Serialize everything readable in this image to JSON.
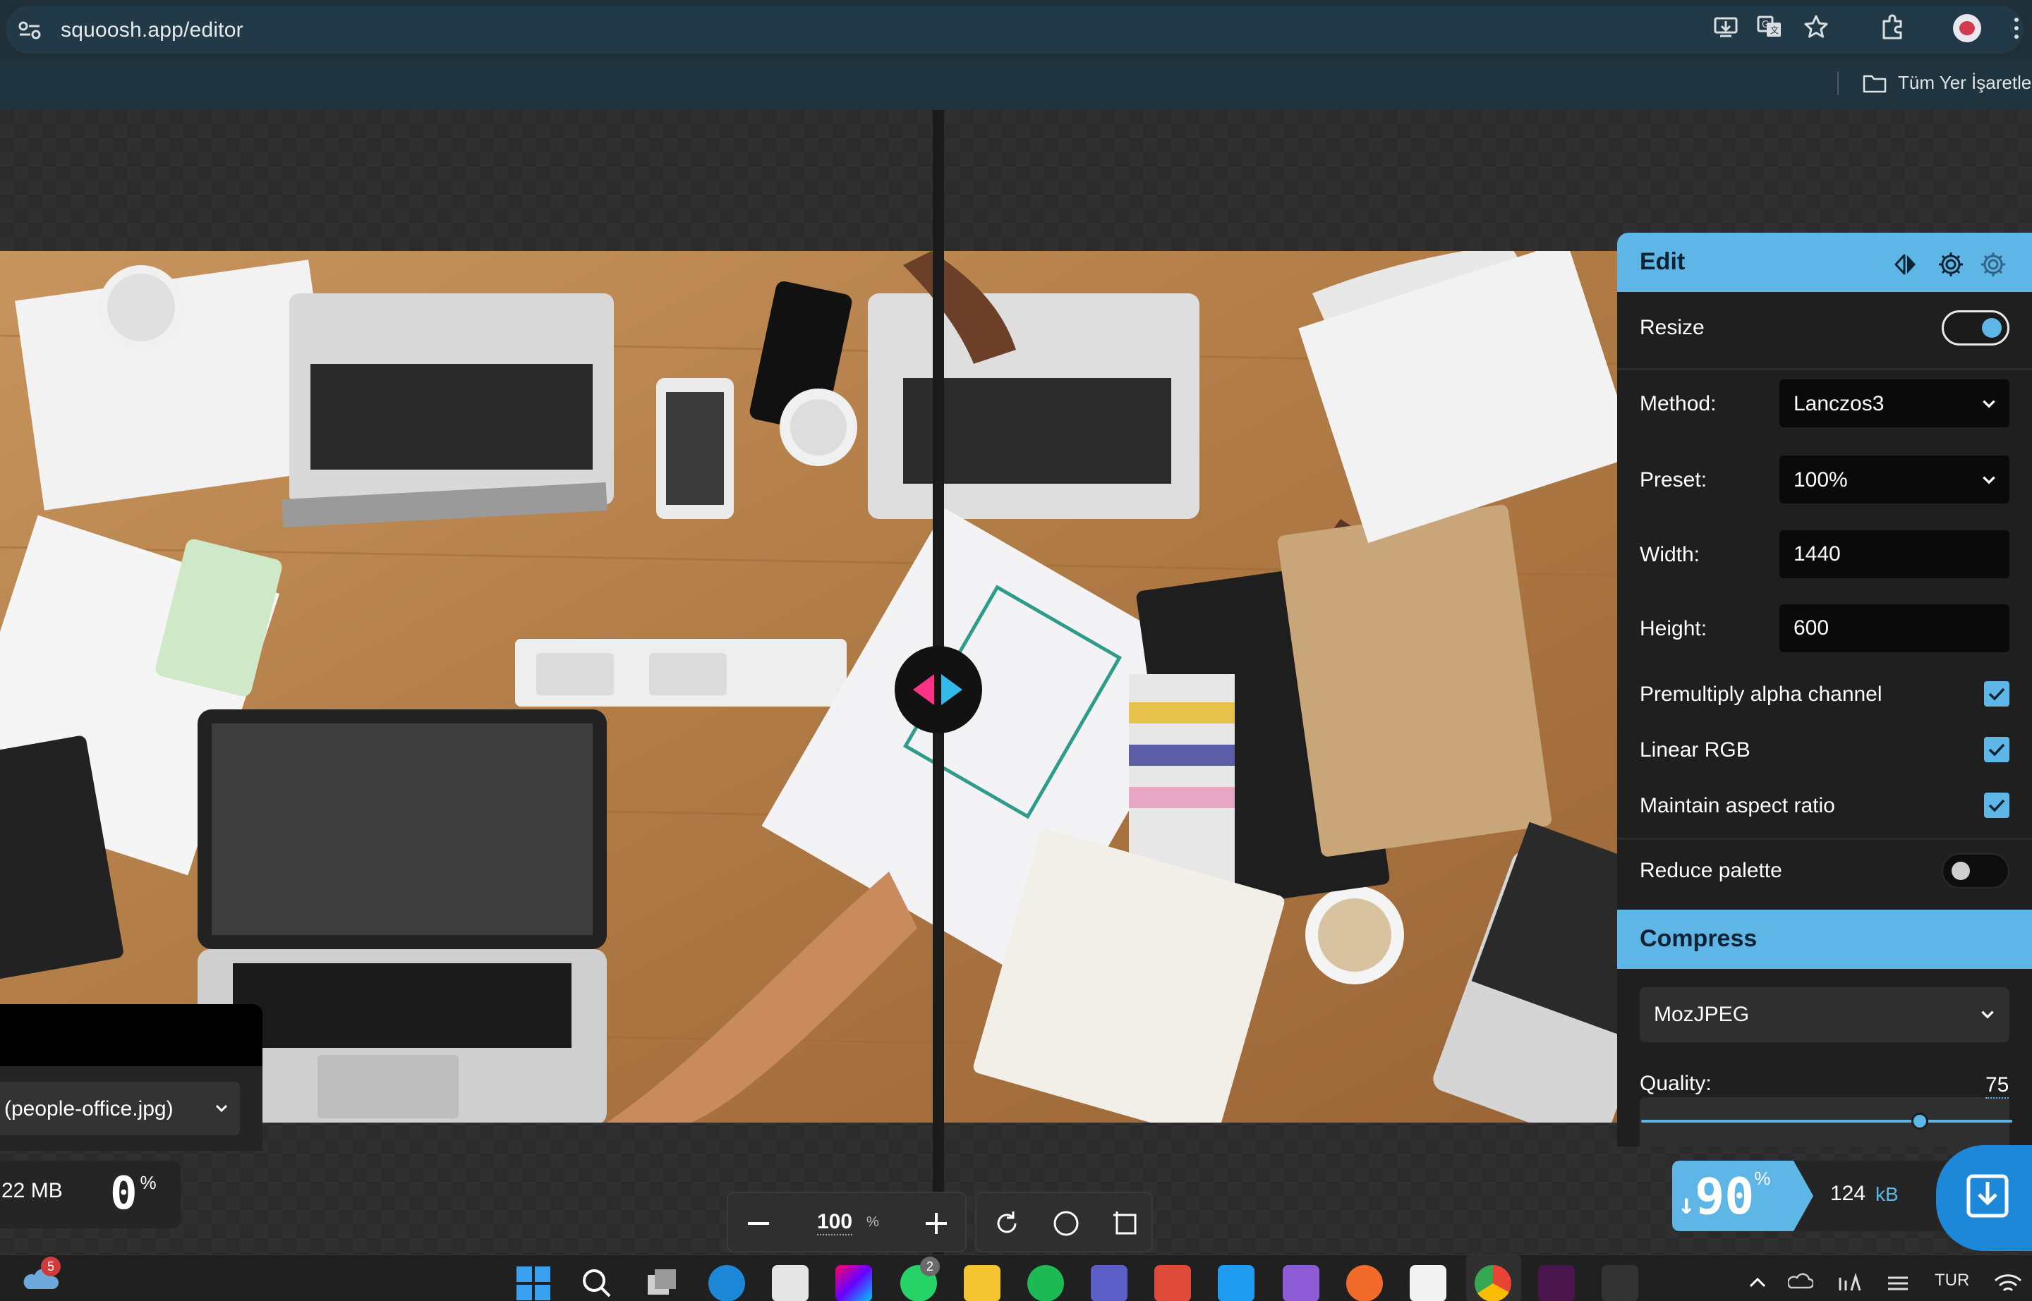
{
  "browser": {
    "url": "squoosh.app/editor",
    "bookmarks_folder_label": "Tüm Yer İşaretleri"
  },
  "canvas": {
    "zoom_value": "100",
    "zoom_unit": "%"
  },
  "left_panel": {
    "file_label": "(people-office.jpg)",
    "original_size": "22 MB",
    "original_percent": "0",
    "percent_unit": "%"
  },
  "edit_panel": {
    "title": "Edit",
    "resize": {
      "label": "Resize",
      "enabled": true
    },
    "method": {
      "label": "Method:",
      "value": "Lanczos3"
    },
    "preset": {
      "label": "Preset:",
      "value": "100%"
    },
    "width": {
      "label": "Width:",
      "value": "1440"
    },
    "height": {
      "label": "Height:",
      "value": "600"
    },
    "premultiply": {
      "label": "Premultiply alpha channel",
      "checked": true
    },
    "linear_rgb": {
      "label": "Linear RGB",
      "checked": true
    },
    "maintain_aspect": {
      "label": "Maintain aspect ratio",
      "checked": true
    },
    "reduce_palette": {
      "label": "Reduce palette",
      "enabled": false
    }
  },
  "compress_panel": {
    "title": "Compress",
    "codec": "MozJPEG",
    "quality_label": "Quality:",
    "quality_value": "75",
    "quality_fraction": 0.75
  },
  "result": {
    "arrow": "↓",
    "percent": "90",
    "percent_unit": "%",
    "size_value": "124",
    "size_unit": "kB"
  },
  "taskbar": {
    "weather_badge": "5",
    "whatsapp_badge": "2",
    "language": "TUR"
  },
  "colors": {
    "accent": "#5eb6e6",
    "download": "#1e88d8",
    "handle_left": "#ff3385",
    "handle_right": "#34b9eb"
  }
}
